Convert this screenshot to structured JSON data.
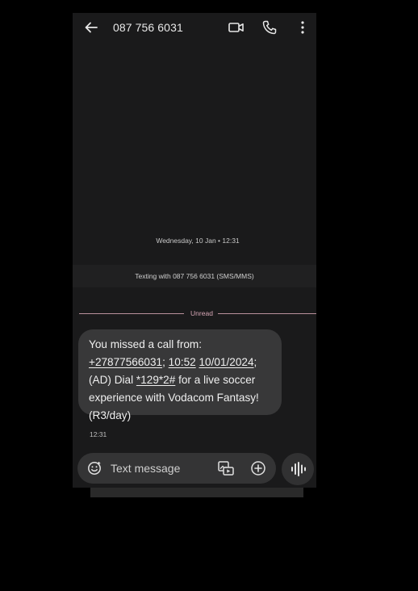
{
  "header": {
    "contact": "087 756 6031",
    "back_icon": "arrow-left-icon",
    "video_icon": "video-camera-icon",
    "call_icon": "phone-icon",
    "more_icon": "more-vertical-icon"
  },
  "conversation": {
    "date_separator": "Wednesday, 10 Jan • 12:31",
    "texting_banner": "Texting with 087 756 6031 (SMS/MMS)",
    "unread_label": "Unread",
    "message": {
      "line1": "You missed a call from:",
      "phone_link": "+27877566031",
      "sep1": ";",
      "time_link": "10:52",
      "date_link": "10/01/2024",
      "sep2": ";",
      "ad_prefix": "(AD) Dial ",
      "ussd_link": "*129*2#",
      "ad_suffix": " for a live soccer",
      "line4": "experience with Vodacom Fantasy!",
      "line5": "(R3/day)"
    },
    "timestamp": "12:31"
  },
  "composer": {
    "placeholder": "Text message",
    "emoji_icon": "emoji-icon",
    "gallery_icon": "gallery-icon",
    "add_icon": "add-circle-icon",
    "voice_icon": "voice-waveform-icon"
  },
  "colors": {
    "background": "#000000",
    "screen": "#1a1a1b",
    "bubble": "#383839",
    "composer": "#343435",
    "unread_accent": "#d7a7b6"
  }
}
